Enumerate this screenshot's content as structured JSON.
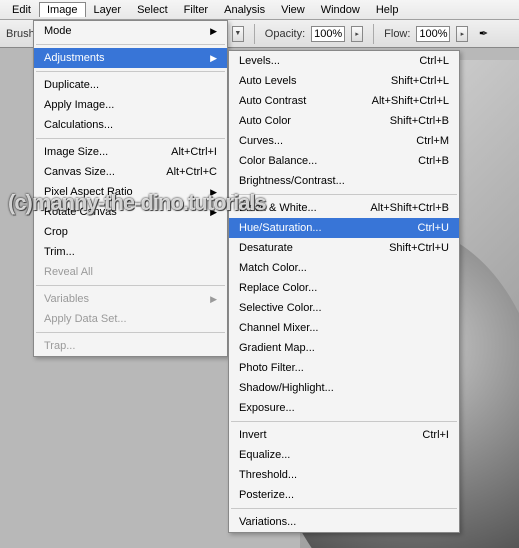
{
  "menubar": {
    "items": [
      "Edit",
      "Image",
      "Layer",
      "Select",
      "Filter",
      "Analysis",
      "View",
      "Window",
      "Help"
    ],
    "open": 1
  },
  "toolbar": {
    "brush_label": "Brush:",
    "opacity_label": "Opacity:",
    "opacity_val": "100%",
    "flow_label": "Flow:",
    "flow_val": "100%"
  },
  "image_menu": {
    "mode": "Mode",
    "adjustments": "Adjustments",
    "duplicate": "Duplicate...",
    "apply_image": "Apply Image...",
    "calculations": "Calculations...",
    "image_size": {
      "l": "Image Size...",
      "s": "Alt+Ctrl+I"
    },
    "canvas_size": {
      "l": "Canvas Size...",
      "s": "Alt+Ctrl+C"
    },
    "pixel_aspect": "Pixel Aspect Ratio",
    "rotate_canvas": "Rotate Canvas",
    "crop": "Crop",
    "trim": "Trim...",
    "reveal_all": "Reveal All",
    "variables": "Variables",
    "apply_data": "Apply Data Set...",
    "trap": "Trap..."
  },
  "adj_menu": {
    "levels": {
      "l": "Levels...",
      "s": "Ctrl+L"
    },
    "auto_levels": {
      "l": "Auto Levels",
      "s": "Shift+Ctrl+L"
    },
    "auto_contrast": {
      "l": "Auto Contrast",
      "s": "Alt+Shift+Ctrl+L"
    },
    "auto_color": {
      "l": "Auto Color",
      "s": "Shift+Ctrl+B"
    },
    "curves": {
      "l": "Curves...",
      "s": "Ctrl+M"
    },
    "color_balance": {
      "l": "Color Balance...",
      "s": "Ctrl+B"
    },
    "bright": "Brightness/Contrast...",
    "bw": {
      "l": "Black & White...",
      "s": "Alt+Shift+Ctrl+B"
    },
    "hue": {
      "l": "Hue/Saturation...",
      "s": "Ctrl+U"
    },
    "desat": {
      "l": "Desaturate",
      "s": "Shift+Ctrl+U"
    },
    "match": "Match Color...",
    "replace": "Replace Color...",
    "selective": "Selective Color...",
    "channel": "Channel Mixer...",
    "gradient": "Gradient Map...",
    "photo": "Photo Filter...",
    "shadow": "Shadow/Highlight...",
    "exposure": "Exposure...",
    "invert": {
      "l": "Invert",
      "s": "Ctrl+I"
    },
    "equalize": "Equalize...",
    "threshold": "Threshold...",
    "posterize": "Posterize...",
    "variations": "Variations..."
  },
  "watermark": "(c)manny-the-dino.tutorials"
}
